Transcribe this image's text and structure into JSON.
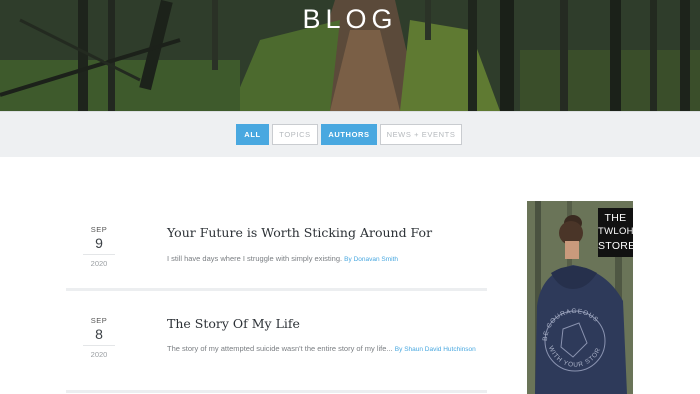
{
  "hero": {
    "title": "BLOG"
  },
  "filters": [
    {
      "label": "ALL",
      "active": true
    },
    {
      "label": "TOPICS",
      "active": false
    },
    {
      "label": "AUTHORS",
      "active": true
    },
    {
      "label": "NEWS + EVENTS",
      "active": false
    }
  ],
  "posts": [
    {
      "month": "SEP",
      "day": "9",
      "year": "2020",
      "title": "Your Future is Worth Sticking Around For",
      "excerpt": "I still have days where I struggle with simply existing.",
      "author": "By Donavan Smith"
    },
    {
      "month": "SEP",
      "day": "8",
      "year": "2020",
      "title": "The Story Of My Life",
      "excerpt": "The story of my attempted suicide wasn't the entire story of my life...",
      "author": "By Shaun David Hutchinson"
    }
  ],
  "ad": {
    "lines": [
      "THE",
      "TWLOHA",
      "STORE"
    ],
    "shirt_text_top": "BE COURAGEOUS",
    "shirt_text_bottom": "WITH YOUR STORY"
  },
  "colors": {
    "accent": "#49a8e0",
    "filter_bar_bg": "#eef0f2"
  }
}
